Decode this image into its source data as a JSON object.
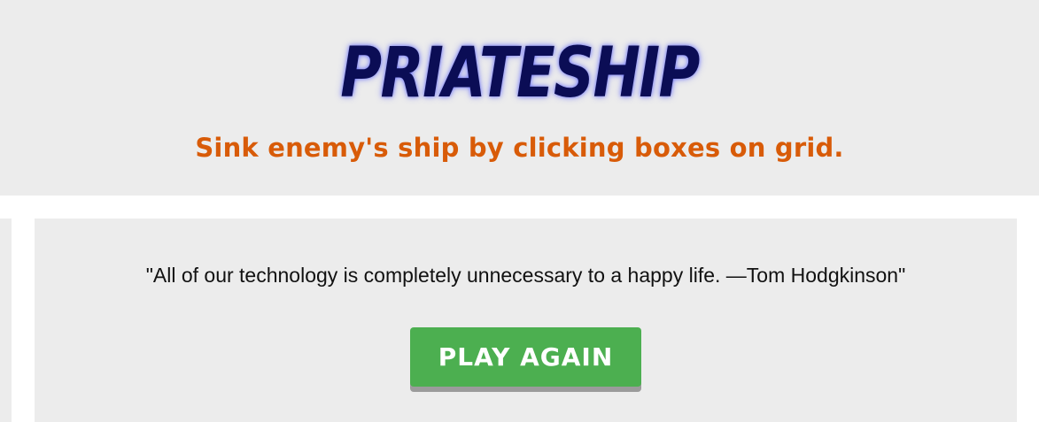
{
  "header": {
    "title": "PRIATESHIP",
    "subtitle": "Sink enemy's ship by clicking boxes on grid."
  },
  "result_panel": {
    "quote": "\"All of our technology is completely unnecessary to a happy life. —Tom Hodgkinson\"",
    "play_again_label": "PLAY AGAIN"
  },
  "colors": {
    "title": "#0b0d55",
    "subtitle": "#d85b08",
    "panel_background": "#ececec",
    "play_button": "#4caf50"
  }
}
